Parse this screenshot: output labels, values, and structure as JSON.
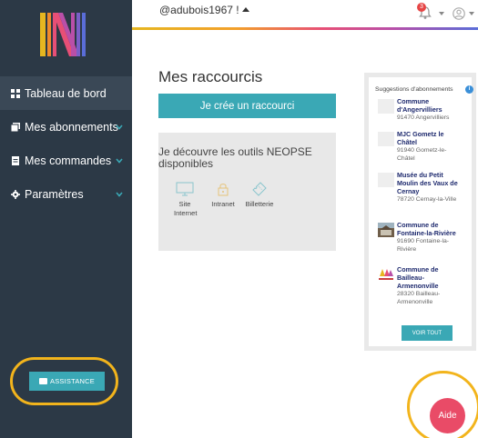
{
  "topbar": {
    "username": "@adubois1967 !",
    "notification_count": "3"
  },
  "sidebar": {
    "items": [
      {
        "label": "Tableau de bord",
        "icon": "dashboard-icon"
      },
      {
        "label": "Mes abonnements",
        "icon": "subscriptions-icon"
      },
      {
        "label": "Mes commandes",
        "icon": "orders-icon"
      },
      {
        "label": "Paramètres",
        "icon": "gear-icon"
      }
    ],
    "assistance_label": "ASSISTANCE"
  },
  "main": {
    "title": "Mes raccourcis",
    "create_button": "Je crée un raccourci",
    "tools_card": {
      "title": "Je découvre les outils NEOPSE disponibles",
      "tools": [
        {
          "label_line1": "Site",
          "label_line2": "Internet"
        },
        {
          "label_line1": "Intranet",
          "label_line2": ""
        },
        {
          "label_line1": "Billetterie",
          "label_line2": ""
        }
      ]
    }
  },
  "suggestions": {
    "title": "Suggestions d'abonnements",
    "items": [
      {
        "name_lines": [
          "Commune",
          "d'Angervilliers"
        ],
        "loc_lines": [
          "91470 Angervilliers"
        ]
      },
      {
        "name_lines": [
          "MJC Gometz le",
          "Châtel"
        ],
        "loc_lines": [
          "91940 Gometz-le-",
          "Châtel"
        ]
      },
      {
        "name_lines": [
          "Musée du Petit",
          "Moulin des Vaux de",
          "Cernay"
        ],
        "loc_lines": [
          "78720 Cernay-la-Ville"
        ]
      },
      {
        "name_lines": [
          "Commune de",
          "Fontaine-la-Rivière"
        ],
        "loc_lines": [
          "91690 Fontaine-la-",
          "Rivière"
        ]
      },
      {
        "name_lines": [
          "Commune de",
          "Bailleau-",
          "Armenonville"
        ],
        "loc_lines": [
          "28320 Bailleau-",
          "Armenonville"
        ]
      }
    ],
    "voir_tout": "VOIR TOUT"
  },
  "aide_label": "Aide",
  "colors": {
    "sidebar_bg": "#2c3946",
    "accent": "#3aa8b5",
    "aide": "#e94b67",
    "highlight": "#f2b41c"
  }
}
